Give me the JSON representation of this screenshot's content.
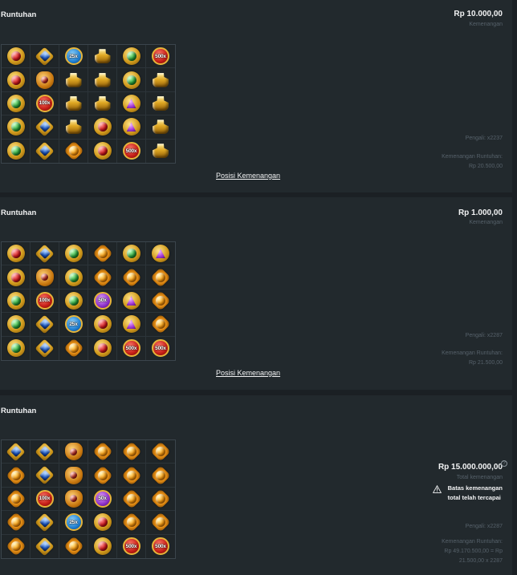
{
  "cards": [
    {
      "title": "Runtuhan",
      "amount": "Rp 10.000,00",
      "amount_sub": "Kemenangan",
      "multiplier": "Pengali: x2237",
      "cascade_label": "Kemenangan Runtuhan:",
      "cascade_value": "Rp 20.500,00",
      "link": "Posisi Kemenangan",
      "grid": [
        [
          "red",
          "blue",
          "25x",
          "gold",
          "green",
          "500x"
        ],
        [
          "red",
          "bag",
          "gold",
          "gold",
          "green",
          "gold"
        ],
        [
          "green",
          "100x",
          "gold",
          "gold",
          "purple",
          "gold"
        ],
        [
          "green",
          "blue-bag",
          "gold",
          "red",
          "purple",
          "gold"
        ],
        [
          "green",
          "blue-bag",
          "orange",
          "red",
          "500x",
          "gold"
        ]
      ]
    },
    {
      "title": "Runtuhan",
      "amount": "Rp 1.000,00",
      "amount_sub": "Kemenangan",
      "multiplier": "Pengali: x2287",
      "cascade_label": "Kemenangan Runtuhan:",
      "cascade_value": "Rp 21.500,00",
      "link": "Posisi Kemenangan",
      "grid": [
        [
          "red",
          "blue",
          "green",
          "orange",
          "green",
          "purple"
        ],
        [
          "red",
          "bag",
          "green",
          "orange",
          "orange",
          "orange"
        ],
        [
          "green",
          "100x",
          "green",
          "50x",
          "purple",
          "orange"
        ],
        [
          "green",
          "blue-bag",
          "25x",
          "red",
          "purple",
          "orange"
        ],
        [
          "green",
          "blue-bag",
          "orange",
          "red",
          "500x",
          "500x"
        ]
      ]
    },
    {
      "title": "Runtuhan",
      "amount": "Rp 15.000.000,00",
      "amount_sub": "Total kemenangan",
      "warning_line1": "Batas kemenangan",
      "warning_line2": "total telah tercapai",
      "multiplier": "Pengali: x2287",
      "cascade_label": "Kemenangan Runtuhan:",
      "cascade_value_1": "Rp 49.170.500,00 = Rp",
      "cascade_value_2": "21.500,00 x 2287",
      "grid": [
        [
          "blue",
          "blue",
          "bag",
          "orange",
          "orange",
          "orange"
        ],
        [
          "orange",
          "blue",
          "bag",
          "orange",
          "orange",
          "orange"
        ],
        [
          "orange",
          "100x",
          "bag",
          "50x",
          "orange",
          "orange"
        ],
        [
          "orange",
          "blue-bag",
          "25x",
          "red",
          "orange",
          "orange"
        ],
        [
          "orange",
          "blue-bag",
          "orange",
          "red",
          "500x",
          "500x"
        ]
      ]
    }
  ]
}
